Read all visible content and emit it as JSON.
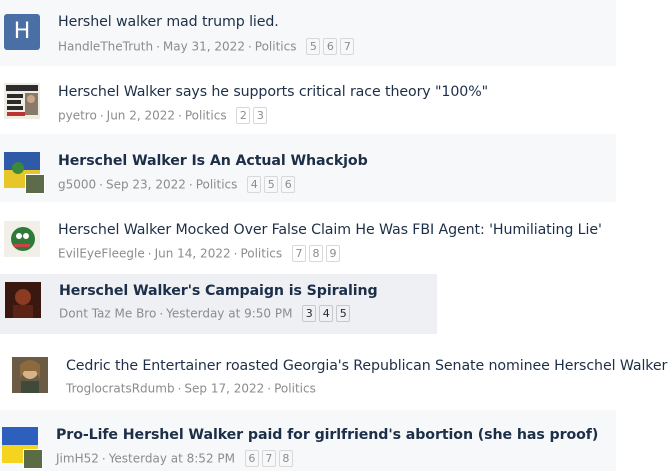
{
  "threads": [
    {
      "title": "Hershel walker mad trump lied.",
      "author": "HandleTheTruth",
      "date": "May 31, 2022",
      "forum": "Politics",
      "pages": [
        "5",
        "6",
        "7"
      ],
      "avatar_letter": "H"
    },
    {
      "title": "Herschel Walker says he supports critical race theory \"100%\"",
      "author": "pyetro",
      "date": "Jun 2, 2022",
      "forum": "Politics",
      "pages": [
        "2",
        "3"
      ],
      "avatar_text": "DAILY NEWS"
    },
    {
      "title": "Herschel Walker Is An Actual Whackjob",
      "author": "g5000",
      "date": "Sep 23, 2022",
      "forum": "Politics",
      "pages": [
        "4",
        "5",
        "6"
      ]
    },
    {
      "title": "Herschel Walker Mocked Over False Claim He Was FBI Agent: 'Humiliating Lie'",
      "author": "EvilEyeFleegle",
      "date": "Jun 14, 2022",
      "forum": "Politics",
      "pages": [
        "7",
        "8",
        "9"
      ]
    },
    {
      "title": "Herschel Walker's Campaign is Spiraling",
      "author": "Dont Taz Me Bro",
      "date": "Yesterday at 9:50 PM",
      "forum": "",
      "pages": [
        "3",
        "4",
        "5"
      ]
    },
    {
      "title": "Cedric the Entertainer roasted Georgia's Republican Senate nominee Herschel Walker",
      "author": "TroglocratsRdumb",
      "date": "Sep 17, 2022",
      "forum": "Politics",
      "pages": []
    },
    {
      "title": "Pro-Life Hershel Walker paid for girlfriend's abortion (she has proof)",
      "author": "JimH52",
      "date": "Yesterday at 8:52 PM",
      "forum": "",
      "pages": [
        "6",
        "7",
        "8"
      ]
    }
  ],
  "separator": "·",
  "colors": {
    "title": "#1d2f48",
    "meta": "#8c8c8c",
    "row_alt": "#f5f6f7",
    "row_highlight": "#eef0f3",
    "avatar_blue": "#4a6fa5"
  }
}
